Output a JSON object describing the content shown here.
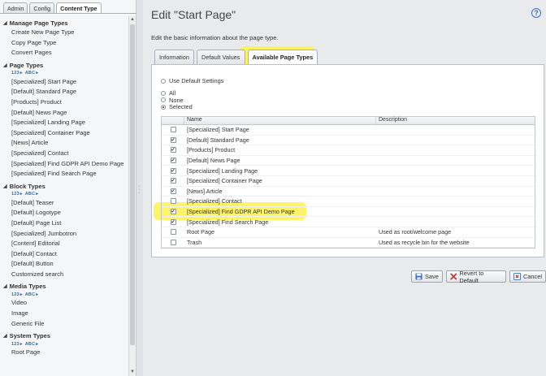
{
  "left": {
    "tabs": [
      {
        "label": "Admin",
        "active": false
      },
      {
        "label": "Config",
        "active": false
      },
      {
        "label": "Content Type",
        "active": true
      }
    ],
    "mini_icons": {
      "numbers": "123",
      "letters": "ABC"
    },
    "sections": [
      {
        "title": "Manage Page Types",
        "has_icons": false,
        "items": [
          "Create New Page Type",
          "Copy Page Type",
          "Convert Pages"
        ]
      },
      {
        "title": "Page Types",
        "has_icons": true,
        "items": [
          "[Specialized] Start Page",
          "[Default] Standard Page",
          "[Products] Product",
          "[Default] News Page",
          "[Specialized] Landing Page",
          "[Specialized] Container Page",
          "[News] Article",
          "[Specialized] Contact",
          "[Specialized] Find GDPR API Demo Page",
          "[Specialized] Find Search Page"
        ]
      },
      {
        "title": "Block Types",
        "has_icons": true,
        "items": [
          "[Default] Teaser",
          "[Default] Logotype",
          "[Default] Page List",
          "[Specialized] Jumbotron",
          "[Content] Editorial",
          "[Default] Contact",
          "[Default] Button",
          "Customized search"
        ]
      },
      {
        "title": "Media Types",
        "has_icons": true,
        "items": [
          "Video",
          "Image",
          "Generic File"
        ]
      },
      {
        "title": "System Types",
        "has_icons": true,
        "items": [
          "Root Page"
        ]
      }
    ]
  },
  "right": {
    "title": "Edit \"Start Page\"",
    "help_glyph": "?",
    "description": "Edit the basic information about the page type.",
    "tabs": [
      {
        "label": "Information",
        "active": false
      },
      {
        "label": "Default Values",
        "active": false
      },
      {
        "label": "Available Page Types",
        "active": true
      }
    ],
    "use_default_label": "Use Default Settings",
    "modes": [
      {
        "label": "All",
        "selected": false
      },
      {
        "label": "None",
        "selected": false
      },
      {
        "label": "Selected",
        "selected": true
      }
    ],
    "grid": {
      "columns": [
        "Name",
        "Description"
      ],
      "rows": [
        {
          "name": "[Specialized] Start Page",
          "description": "",
          "checked": false
        },
        {
          "name": "[Default] Standard Page",
          "description": "",
          "checked": true
        },
        {
          "name": "[Products] Product",
          "description": "",
          "checked": true
        },
        {
          "name": "[Default] News Page",
          "description": "",
          "checked": true
        },
        {
          "name": "[Specialized] Landing Page",
          "description": "",
          "checked": true
        },
        {
          "name": "[Specialized] Container Page",
          "description": "",
          "checked": true
        },
        {
          "name": "[News] Article",
          "description": "",
          "checked": true
        },
        {
          "name": "[Specialized] Contact",
          "description": "",
          "checked": false
        },
        {
          "name": "[Specialized] Find GDPR API Demo Page",
          "description": "",
          "checked": true,
          "highlight": true
        },
        {
          "name": "[Specialized] Find Search Page",
          "description": "",
          "checked": true
        },
        {
          "name": "Root Page",
          "description": "Used as root/welcome page",
          "checked": false
        },
        {
          "name": "Trash",
          "description": "Used as recycle bin for the website",
          "checked": false
        }
      ]
    },
    "buttons": {
      "save": "Save",
      "revert": "Revert to Default",
      "cancel": "Cancel"
    }
  },
  "colors": {
    "highlight": "#fff24a",
    "accent": "#3b6fb5",
    "danger": "#d9352c"
  }
}
